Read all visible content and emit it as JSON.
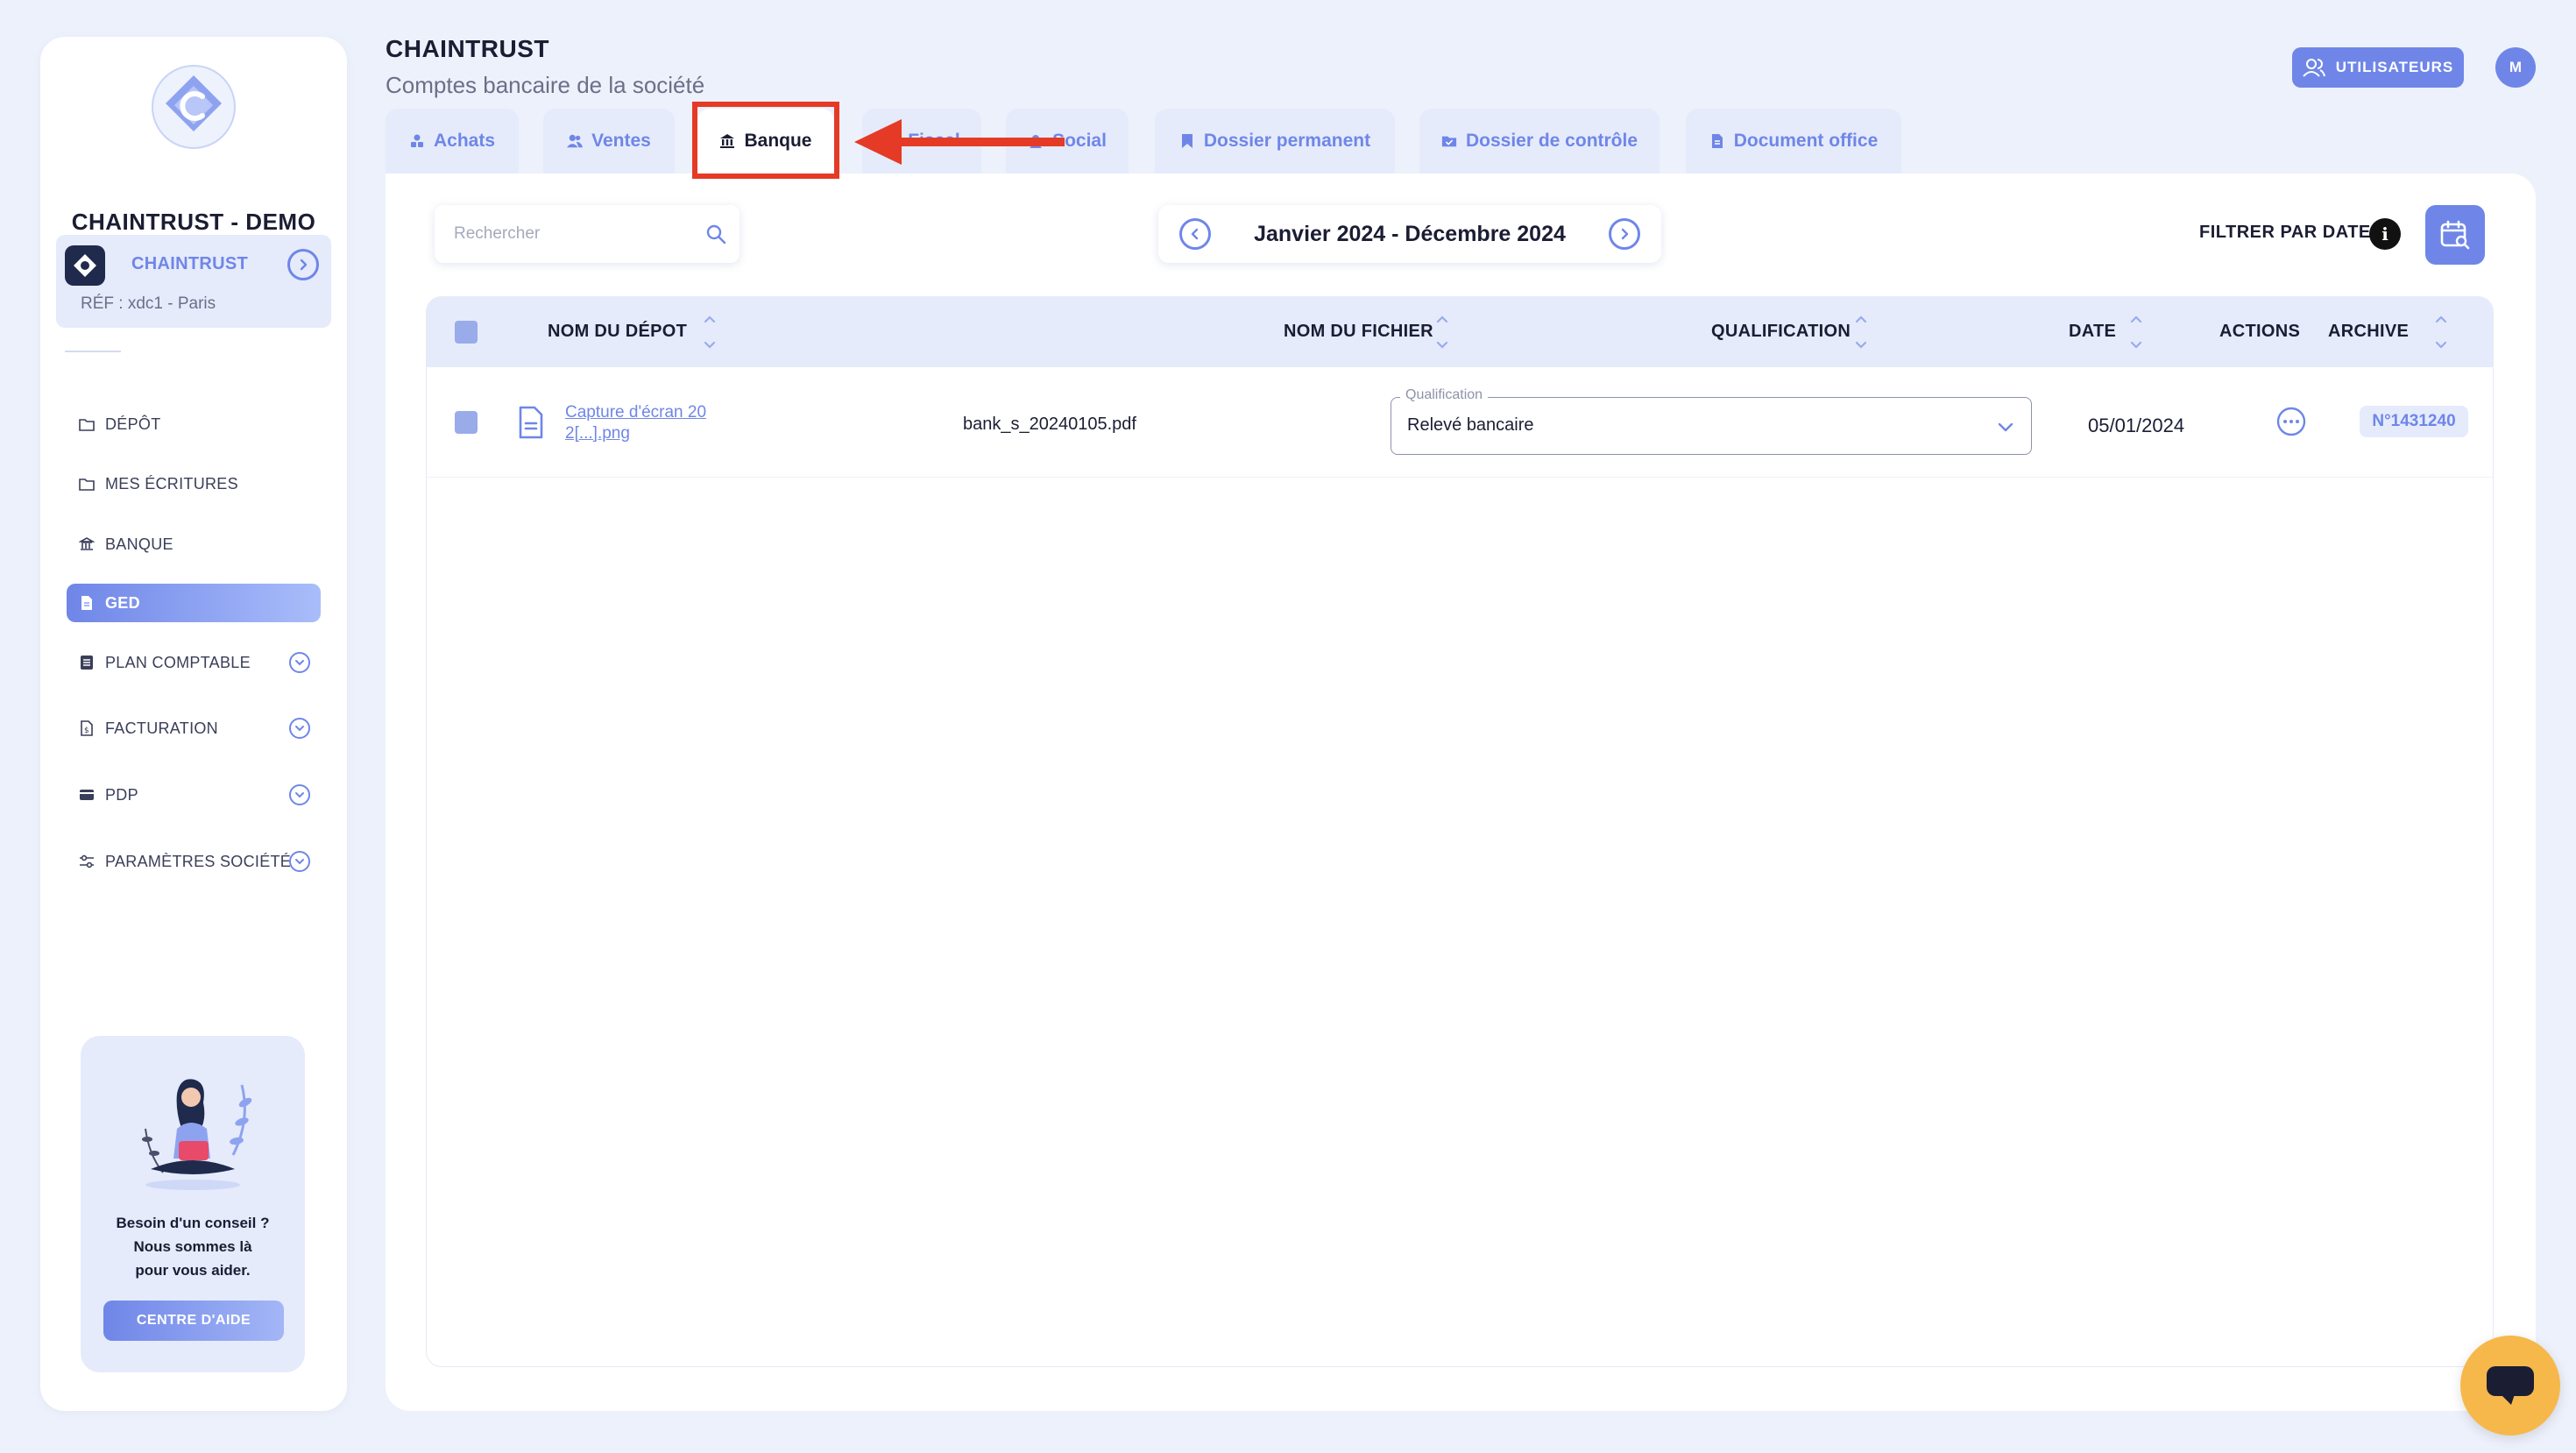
{
  "sidebar": {
    "company_name": "CHAINTRUST - DEMO",
    "company_card": {
      "name": "CHAINTRUST",
      "ref": "RÉF : xdc1 - Paris"
    },
    "nav": [
      {
        "label": "DÉPÔT",
        "icon": "folder-icon",
        "has_submenu": false,
        "active": false
      },
      {
        "label": "MES ÉCRITURES",
        "icon": "folder-icon",
        "has_submenu": false,
        "active": false
      },
      {
        "label": "BANQUE",
        "icon": "bank-icon",
        "has_submenu": false,
        "active": false
      },
      {
        "label": "GED",
        "icon": "document-icon",
        "has_submenu": false,
        "active": true
      },
      {
        "label": "PLAN COMPTABLE",
        "icon": "ledger-icon",
        "has_submenu": true,
        "active": false
      },
      {
        "label": "FACTURATION",
        "icon": "invoice-icon",
        "has_submenu": true,
        "active": false
      },
      {
        "label": "PDP",
        "icon": "card-icon",
        "has_submenu": true,
        "active": false
      },
      {
        "label": "PARAMÈTRES SOCIÉTÉ",
        "icon": "sliders-icon",
        "has_submenu": true,
        "active": false
      }
    ],
    "help": {
      "line1": "Besoin d'un conseil ?",
      "line2": "Nous sommes là",
      "line3": "pour vous aider.",
      "button": "CENTRE D'AIDE"
    }
  },
  "header": {
    "title": "CHAINTRUST",
    "subtitle": "Comptes bancaire de la société",
    "users_button": "UTILISATEURS",
    "avatar_initial": "M"
  },
  "tabs": [
    {
      "label": "Achats",
      "icon": "purchases-icon",
      "active": false
    },
    {
      "label": "Ventes",
      "icon": "users-icon",
      "active": false
    },
    {
      "label": "Banque",
      "icon": "bank-icon",
      "active": true
    },
    {
      "label": "Fiscal",
      "icon": "fiscal-icon",
      "active": false
    },
    {
      "label": "Social",
      "icon": "social-icon",
      "active": false
    },
    {
      "label": "Dossier permanent",
      "icon": "bookmark-icon",
      "active": false
    },
    {
      "label": "Dossier de contrôle",
      "icon": "folder-check-icon",
      "active": false
    },
    {
      "label": "Document office",
      "icon": "file-icon",
      "active": false
    }
  ],
  "toolbar": {
    "search_placeholder": "Rechercher",
    "period_label": "Janvier 2024 - Décembre 2024",
    "filter_label": "FILTRER PAR DATE"
  },
  "table": {
    "columns": {
      "depot": "NOM DU DÉPOT",
      "fichier": "NOM DU FICHIER",
      "qualification": "QUALIFICATION",
      "date": "DATE",
      "actions": "ACTIONS",
      "archive": "ARCHIVE"
    },
    "rows": [
      {
        "depot_line1": "Capture d'écran 20",
        "depot_line2": "2[...].png",
        "fichier": "bank_s_20240105.pdf",
        "qualification_legend": "Qualification",
        "qualification": "Relevé bancaire",
        "date": "05/01/2024",
        "archive": "N°1431240"
      }
    ]
  },
  "colors": {
    "accent": "#6f86e8",
    "background": "#edf1fb",
    "highlight": "#e53a25",
    "chat": "#f6b84b"
  }
}
